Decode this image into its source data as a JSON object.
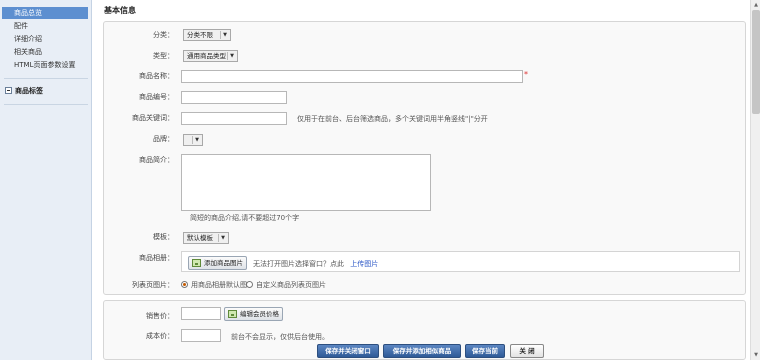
{
  "sidebar": {
    "items": [
      {
        "label": "商品总览"
      },
      {
        "label": "配件"
      },
      {
        "label": "详细介绍"
      },
      {
        "label": "相关商品"
      },
      {
        "label": "HTML页面参数设置"
      }
    ],
    "group": "商品标签"
  },
  "section": {
    "title": "基本信息"
  },
  "form": {
    "category": {
      "label": "分类：",
      "value": "分类不限"
    },
    "type": {
      "label": "类型：",
      "value": "通用商品类型"
    },
    "name": {
      "label": "商品名称：",
      "value": "",
      "required_mark": "*"
    },
    "sku": {
      "label": "商品编号：",
      "value": ""
    },
    "keywords": {
      "label": "商品关键词：",
      "value": "",
      "hint": "仅用于在前台、后台筛选商品，多个关键词用半角竖线\"|\"分开"
    },
    "brand": {
      "label": "品牌：",
      "value": ""
    },
    "brief": {
      "label": "商品简介：",
      "value": "",
      "hint": "简短的商品介绍,请不要超过70个字"
    },
    "template": {
      "label": "模板：",
      "value": "默认模板"
    },
    "album": {
      "label": "商品相册：",
      "add_button": "添加商品图片",
      "hint": "无法打开图片选择窗口？点此",
      "upload_link": "上传图片"
    },
    "list_image": {
      "label": "列表页图片：",
      "option1": "用商品相册默认图",
      "option2": "自定义商品列表页图片"
    },
    "price": {
      "label": "销售价：",
      "value": "",
      "member_price_button": "编辑会员价格"
    },
    "cost": {
      "label": "成本价：",
      "value": "",
      "hint": "前台不会显示，仅供后台使用。"
    }
  },
  "toolbar": {
    "save_close": "保存并关闭窗口",
    "save_add": "保存并添加相似商品",
    "save_current": "保存当前",
    "close": "关  闭"
  },
  "icons": {
    "image_button": "image-icon",
    "scroll_up": "arrow-up-icon",
    "scroll_down": "arrow-down-icon"
  },
  "colors": {
    "active_sidebar": "#5d8fd0",
    "primary_button": "#3d6aa9",
    "required": "#dd3333",
    "link": "#2a56c6"
  }
}
